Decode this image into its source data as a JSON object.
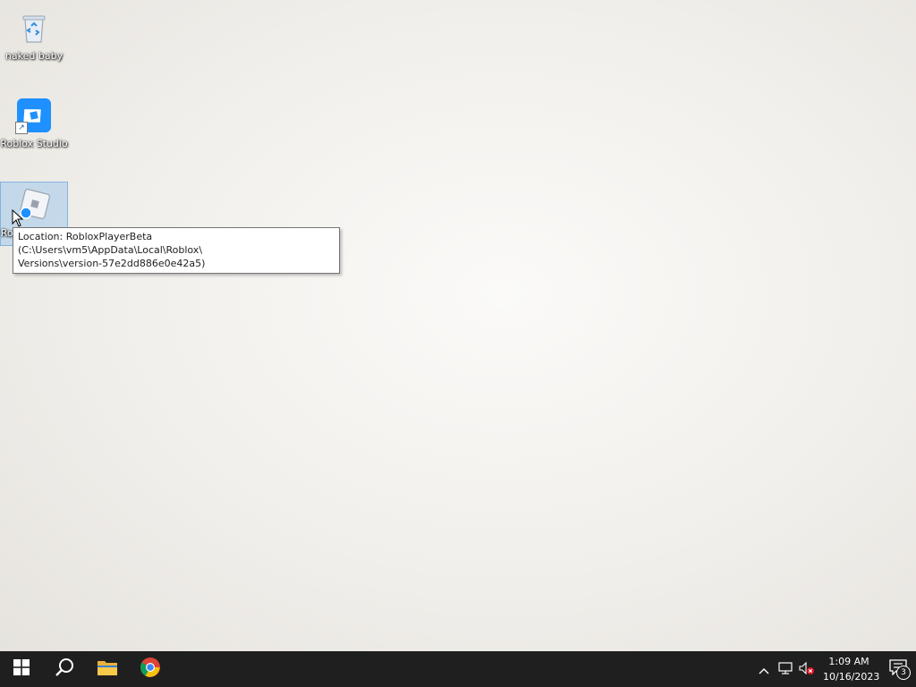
{
  "desktop": {
    "wallpaper_color": "#f1efeb",
    "icons": [
      {
        "label": "naked baby",
        "icon": "recycle-bin-icon"
      },
      {
        "label": "Roblox Studio",
        "icon": "roblox-studio-icon",
        "shortcut": true
      },
      {
        "label": "Roblox Player",
        "icon": "roblox-player-icon",
        "selected": true
      }
    ]
  },
  "tooltip": {
    "line1": "Location: RobloxPlayerBeta (C:\\Users\\vm5\\AppData\\Local\\Roblox\\",
    "line2": "Versions\\version-57e2dd886e0e42a5)"
  },
  "taskbar": {
    "background": "#1f1f1f",
    "pinned": [
      {
        "name": "start",
        "icon": "windows-logo-icon"
      },
      {
        "name": "search",
        "icon": "search-icon"
      },
      {
        "name": "file-explorer",
        "icon": "folder-icon"
      },
      {
        "name": "chrome",
        "icon": "chrome-icon"
      }
    ],
    "tray": {
      "icons": [
        "chevron-up-icon",
        "network-icon",
        "volume-muted-icon"
      ],
      "time": "1:09 AM",
      "date": "10/16/2023",
      "notification_count": "3"
    }
  }
}
